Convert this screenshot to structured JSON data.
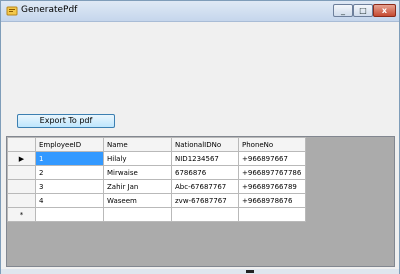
{
  "window": {
    "title": "GeneratePdf"
  },
  "toolbar": {
    "export_label": "Export To pdf"
  },
  "icons": {
    "app": "app-icon",
    "minimize": "minimize-icon",
    "maximize": "maximize-icon",
    "close": "close-icon",
    "current_row": "current-row-arrow-icon",
    "new_row": "new-row-asterisk-icon"
  },
  "grid": {
    "headers": [
      "EmployeeID",
      "Name",
      "NationalIDNo",
      "PhoneNo"
    ],
    "rows": [
      [
        "1",
        "Hilaly",
        "NID1234567",
        "+966897667"
      ],
      [
        "2",
        "Mirwaise",
        "6786876",
        "+966897767786"
      ],
      [
        "3",
        "Zahir Jan",
        "Abc-67687767",
        "+96689766789"
      ],
      [
        "4",
        "Waseem",
        "zvw-67687767",
        "+9668978676"
      ]
    ],
    "current_row_marker": "▶",
    "new_row_marker": "*"
  }
}
